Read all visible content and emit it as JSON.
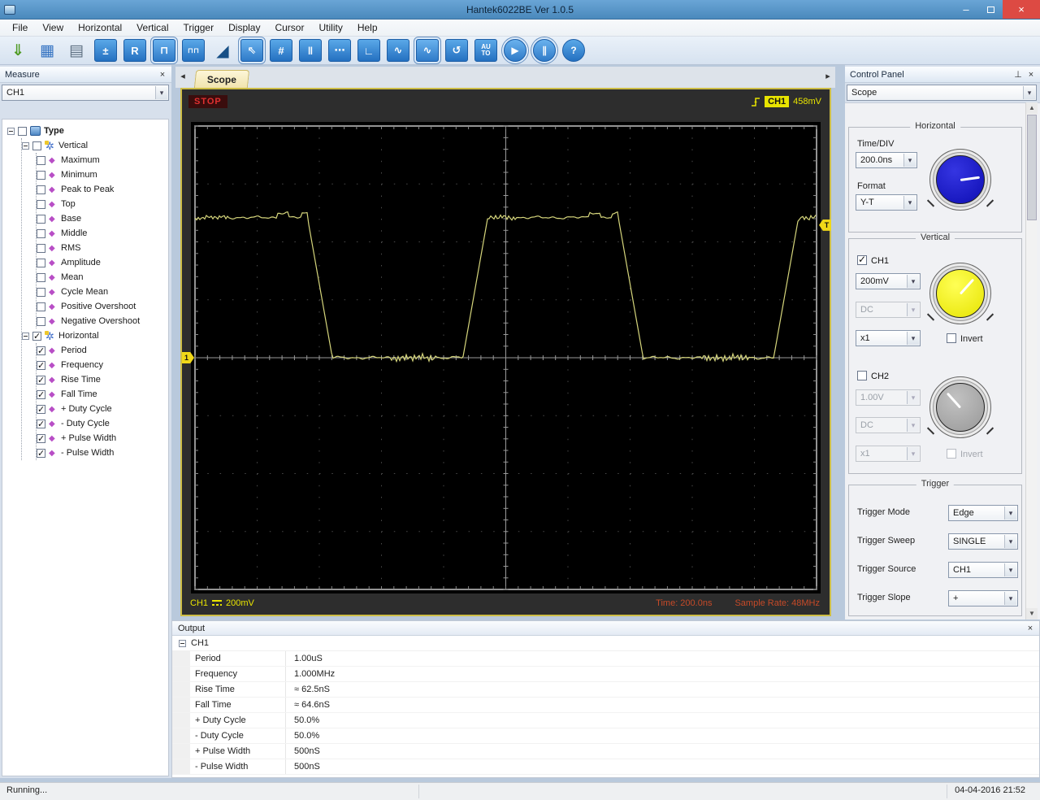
{
  "window": {
    "title": "Hantek6022BE Ver 1.0.5"
  },
  "menubar": {
    "items": [
      "File",
      "View",
      "Horizontal",
      "Vertical",
      "Trigger",
      "Display",
      "Cursor",
      "Utility",
      "Help"
    ]
  },
  "toolbar": {
    "icons": [
      {
        "name": "open-icon",
        "glyph": "⇓",
        "kind": "light",
        "tint": "#4e9a22"
      },
      {
        "name": "save-icon",
        "glyph": "▦",
        "kind": "light",
        "tint": "#3372c2"
      },
      {
        "name": "print-icon",
        "glyph": "▤",
        "kind": "light",
        "tint": "#5c6e80"
      },
      {
        "name": "math-fft-icon",
        "glyph": "±",
        "kind": "tile"
      },
      {
        "name": "reference-wave-icon",
        "glyph": "R",
        "kind": "tile"
      },
      {
        "name": "pulse-view-icon",
        "glyph": "⊓",
        "kind": "tile",
        "active": true
      },
      {
        "name": "dual-pulse-view-icon",
        "glyph": "⊓⊓",
        "kind": "tile"
      },
      {
        "name": "trigger-slope-icon",
        "glyph": "◢",
        "kind": "plain"
      },
      {
        "name": "cursor-select-icon",
        "glyph": "⇖",
        "kind": "tile",
        "active": true
      },
      {
        "name": "grid-icon",
        "glyph": "#",
        "kind": "tile"
      },
      {
        "name": "vertical-cursor-icon",
        "glyph": "‖",
        "kind": "tile"
      },
      {
        "name": "horizontal-cursor-icon",
        "glyph": "⋯",
        "kind": "tile"
      },
      {
        "name": "step-wave-icon",
        "glyph": "∟",
        "kind": "tile"
      },
      {
        "name": "sine-wave-icon",
        "glyph": "∿",
        "kind": "tile"
      },
      {
        "name": "sine-fit-icon",
        "glyph": "∿",
        "kind": "tile",
        "active": true
      },
      {
        "name": "refresh-icon",
        "glyph": "↺",
        "kind": "tile"
      },
      {
        "name": "auto-set-icon",
        "glyph": "AU|TO",
        "kind": "tile"
      },
      {
        "name": "start-icon",
        "glyph": "▶",
        "kind": "round",
        "active": true
      },
      {
        "name": "pause-icon",
        "glyph": "∥",
        "kind": "round",
        "active": true
      },
      {
        "name": "help-icon",
        "glyph": "?",
        "kind": "round"
      }
    ]
  },
  "measure": {
    "title": "Measure",
    "channel": "CH1",
    "tree": {
      "label": "Type",
      "checked": false,
      "children": [
        {
          "label": "Vertical",
          "checked": false,
          "children": [
            {
              "label": "Maximum",
              "checked": false
            },
            {
              "label": "Minimum",
              "checked": false
            },
            {
              "label": "Peak to Peak",
              "checked": false
            },
            {
              "label": "Top",
              "checked": false
            },
            {
              "label": "Base",
              "checked": false
            },
            {
              "label": "Middle",
              "checked": false
            },
            {
              "label": "RMS",
              "checked": false
            },
            {
              "label": "Amplitude",
              "checked": false
            },
            {
              "label": "Mean",
              "checked": false
            },
            {
              "label": "Cycle Mean",
              "checked": false
            },
            {
              "label": "Positive Overshoot",
              "checked": false
            },
            {
              "label": "Negative Overshoot",
              "checked": false
            }
          ]
        },
        {
          "label": "Horizontal",
          "checked": true,
          "children": [
            {
              "label": "Period",
              "checked": true
            },
            {
              "label": "Frequency",
              "checked": true
            },
            {
              "label": "Rise Time",
              "checked": true
            },
            {
              "label": "Fall Time",
              "checked": true
            },
            {
              "label": "+ Duty Cycle",
              "checked": true
            },
            {
              "label": "- Duty Cycle",
              "checked": true
            },
            {
              "label": "+ Pulse Width",
              "checked": true
            },
            {
              "label": "- Pulse Width",
              "checked": true
            }
          ]
        }
      ]
    }
  },
  "tabs": {
    "active": "Scope"
  },
  "scope": {
    "status": "STOP",
    "trigger_channel": "CH1",
    "trigger_level": "458mV",
    "channel_label": "CH1",
    "volts_per_div_label": "200mV",
    "time_label": "Time: 200.0ns",
    "sample_rate_label": "Sample Rate: 48MHz",
    "channel_marker": "1",
    "trigger_marker": "T"
  },
  "control_panel": {
    "title": "Control Panel",
    "mode": "Scope",
    "horizontal": {
      "group": "Horizontal",
      "time_div_label": "Time/DIV",
      "time_div": "200.0ns",
      "format_label": "Format",
      "format": "Y-T"
    },
    "vertical": {
      "group": "Vertical",
      "ch1": {
        "label": "CH1",
        "checked": true,
        "volts": "200mV",
        "coupling": "DC",
        "probe": "x1",
        "invert_label": "Invert"
      },
      "ch2": {
        "label": "CH2",
        "checked": false,
        "volts": "1.00V",
        "coupling": "DC",
        "probe": "x1",
        "invert_label": "Invert"
      }
    },
    "trigger": {
      "group": "Trigger",
      "rows": [
        {
          "label": "Trigger Mode",
          "value": "Edge"
        },
        {
          "label": "Trigger Sweep",
          "value": "SINGLE"
        },
        {
          "label": "Trigger Source",
          "value": "CH1"
        },
        {
          "label": "Trigger Slope",
          "value": "+"
        }
      ]
    }
  },
  "output": {
    "title": "Output",
    "group": "CH1",
    "rows": [
      [
        "Period",
        "1.00uS"
      ],
      [
        "Frequency",
        "1.000MHz"
      ],
      [
        "Rise Time",
        "≈ 62.5nS"
      ],
      [
        "Fall Time",
        "≈ 64.6nS"
      ],
      [
        "+ Duty Cycle",
        "50.0%"
      ],
      [
        "- Duty Cycle",
        "50.0%"
      ],
      [
        "+ Pulse Width",
        "500nS"
      ],
      [
        "- Pulse Width",
        "500nS"
      ]
    ]
  },
  "statusbar": {
    "status": "Running...",
    "datetime": "04-04-2016 21:52"
  },
  "colors": {
    "trace": "#d6d67c",
    "scope_border": "#cdbd45",
    "badge_yellow": "#e8e400",
    "stop_red": "#e03030",
    "time_text": "#c64a28",
    "titlebar_blue": "#4a89bc",
    "close_red": "#dd4a43"
  },
  "chart_data": {
    "type": "line",
    "title": "CH1 square wave capture",
    "signal": "square",
    "time_per_div": "200.0ns",
    "volts_per_div": "200mV",
    "sample_rate": "48MHz",
    "divisions": {
      "x": 10,
      "y": 8
    },
    "period_divs": 5.0,
    "duty_cycle_pct": 50.0,
    "high_level_divs_above_center": 2.42,
    "low_level_divs_above_center": 0.0,
    "edges_div": [
      {
        "x": 1.81,
        "dir": "fall"
      },
      {
        "x": 4.31,
        "dir": "rise"
      },
      {
        "x": 6.81,
        "dir": "fall"
      },
      {
        "x": 9.31,
        "dir": "rise"
      }
    ],
    "transition_width_div": 0.4,
    "trigger_level_divs_above_center": 2.29,
    "channel_zero_divs_above_center": 0.0,
    "trace_color": "#d6d67c",
    "measurements": {
      "period": "1.00uS",
      "frequency": "1.000MHz",
      "rise_time": "62.5nS",
      "fall_time": "64.6nS",
      "pos_pulse_width": "500nS",
      "neg_pulse_width": "500nS"
    }
  }
}
